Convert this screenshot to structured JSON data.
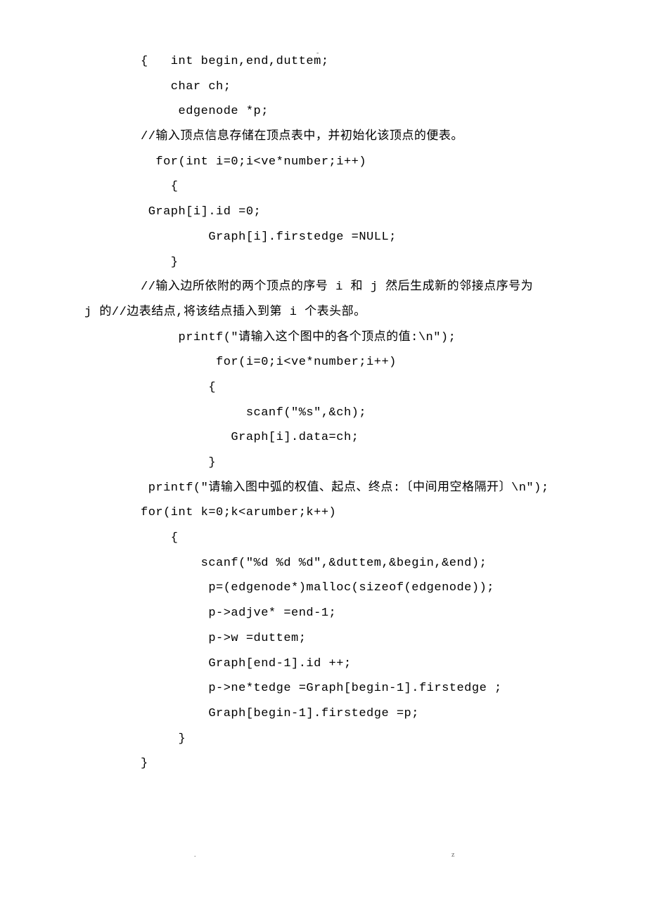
{
  "header": {
    "dash": "-"
  },
  "footer": {
    "left": ".",
    "right": "z"
  },
  "lines": {
    "l1": "{   int begin,end,duttem;",
    "l2": "    char ch;",
    "l3": "     edgenode *p;",
    "l4": "//输入顶点信息存储在顶点表中，并初始化该顶点的便表。",
    "l5": "  for(int i=0;i<ve*number;i++)",
    "l6": "    {",
    "l7": " Graph[i].id =0;",
    "l8": "         Graph[i].firstedge =NULL;",
    "l9": "    }",
    "l10": "//输入边所依附的两个顶点的序号 i 和 j 然后生成新的邻接点序号为",
    "l11": "j 的//边表结点,将该结点插入到第 i 个表头部。",
    "l12": "     printf(\"请输入这个图中的各个顶点的值:\\n\");",
    "l13": "          for(i=0;i<ve*number;i++)",
    "l14": "         {",
    "l15": "              scanf(\"%s\",&ch);",
    "l16": "            Graph[i].data=ch;",
    "l17": "         }",
    "l18": " printf(\"请输入图中弧的权值、起点、终点:〔中间用空格隔开〕\\n\");",
    "l19": "for(int k=0;k<arumber;k++)",
    "l20": "    {",
    "l21": "        scanf(\"%d %d %d\",&duttem,&begin,&end);",
    "l22": "         p=(edgenode*)malloc(sizeof(edgenode));",
    "l23": "         p->adjve* =end-1;",
    "l24": "         p->w =duttem;",
    "l25": "         Graph[end-1].id ++;",
    "l26": "         p->ne*tedge =Graph[begin-1].firstedge ;",
    "l27": "         Graph[begin-1].firstedge =p;",
    "l28": "     }",
    "l29": "}"
  }
}
